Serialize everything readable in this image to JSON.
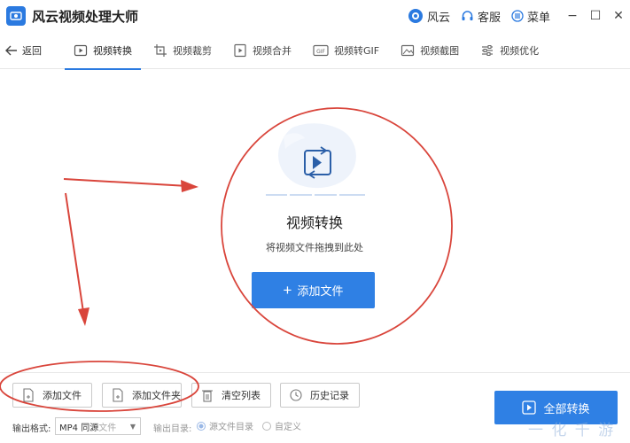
{
  "app": {
    "title": "风云视频处理大师"
  },
  "titlebar": {
    "brand_label": "风云",
    "service_label": "客服",
    "menu_label": "菜单",
    "minimize": "−",
    "maximize": "☐",
    "close": "✕"
  },
  "nav": {
    "back_label": "返回",
    "tabs": [
      {
        "label": "视频转换",
        "icon": "convert-icon",
        "active": true
      },
      {
        "label": "视频裁剪",
        "icon": "crop-icon"
      },
      {
        "label": "视频合并",
        "icon": "merge-icon"
      },
      {
        "label": "视频转GIF",
        "icon": "gif-icon"
      },
      {
        "label": "视频截图",
        "icon": "screenshot-icon"
      },
      {
        "label": "视频优化",
        "icon": "optimize-icon"
      }
    ]
  },
  "dropzone": {
    "title": "视频转换",
    "hint": "将视频文件拖拽到此处",
    "add_label": "添加文件"
  },
  "bottom": {
    "add_file": "添加文件",
    "add_folder": "添加文件夹",
    "clear_list": "清空列表",
    "history": "历史记录",
    "format_label": "输出格式:",
    "format_value": "MP4 同源",
    "format_faded": "文件",
    "output_label": "输出目录:",
    "radio_source": "源文件目录",
    "radio_custom": "自定义",
    "convert_all": "全部转换",
    "watermark": "一 化 千 游"
  },
  "colors": {
    "accent": "#2f80e4",
    "annotation": "#d9453b"
  }
}
